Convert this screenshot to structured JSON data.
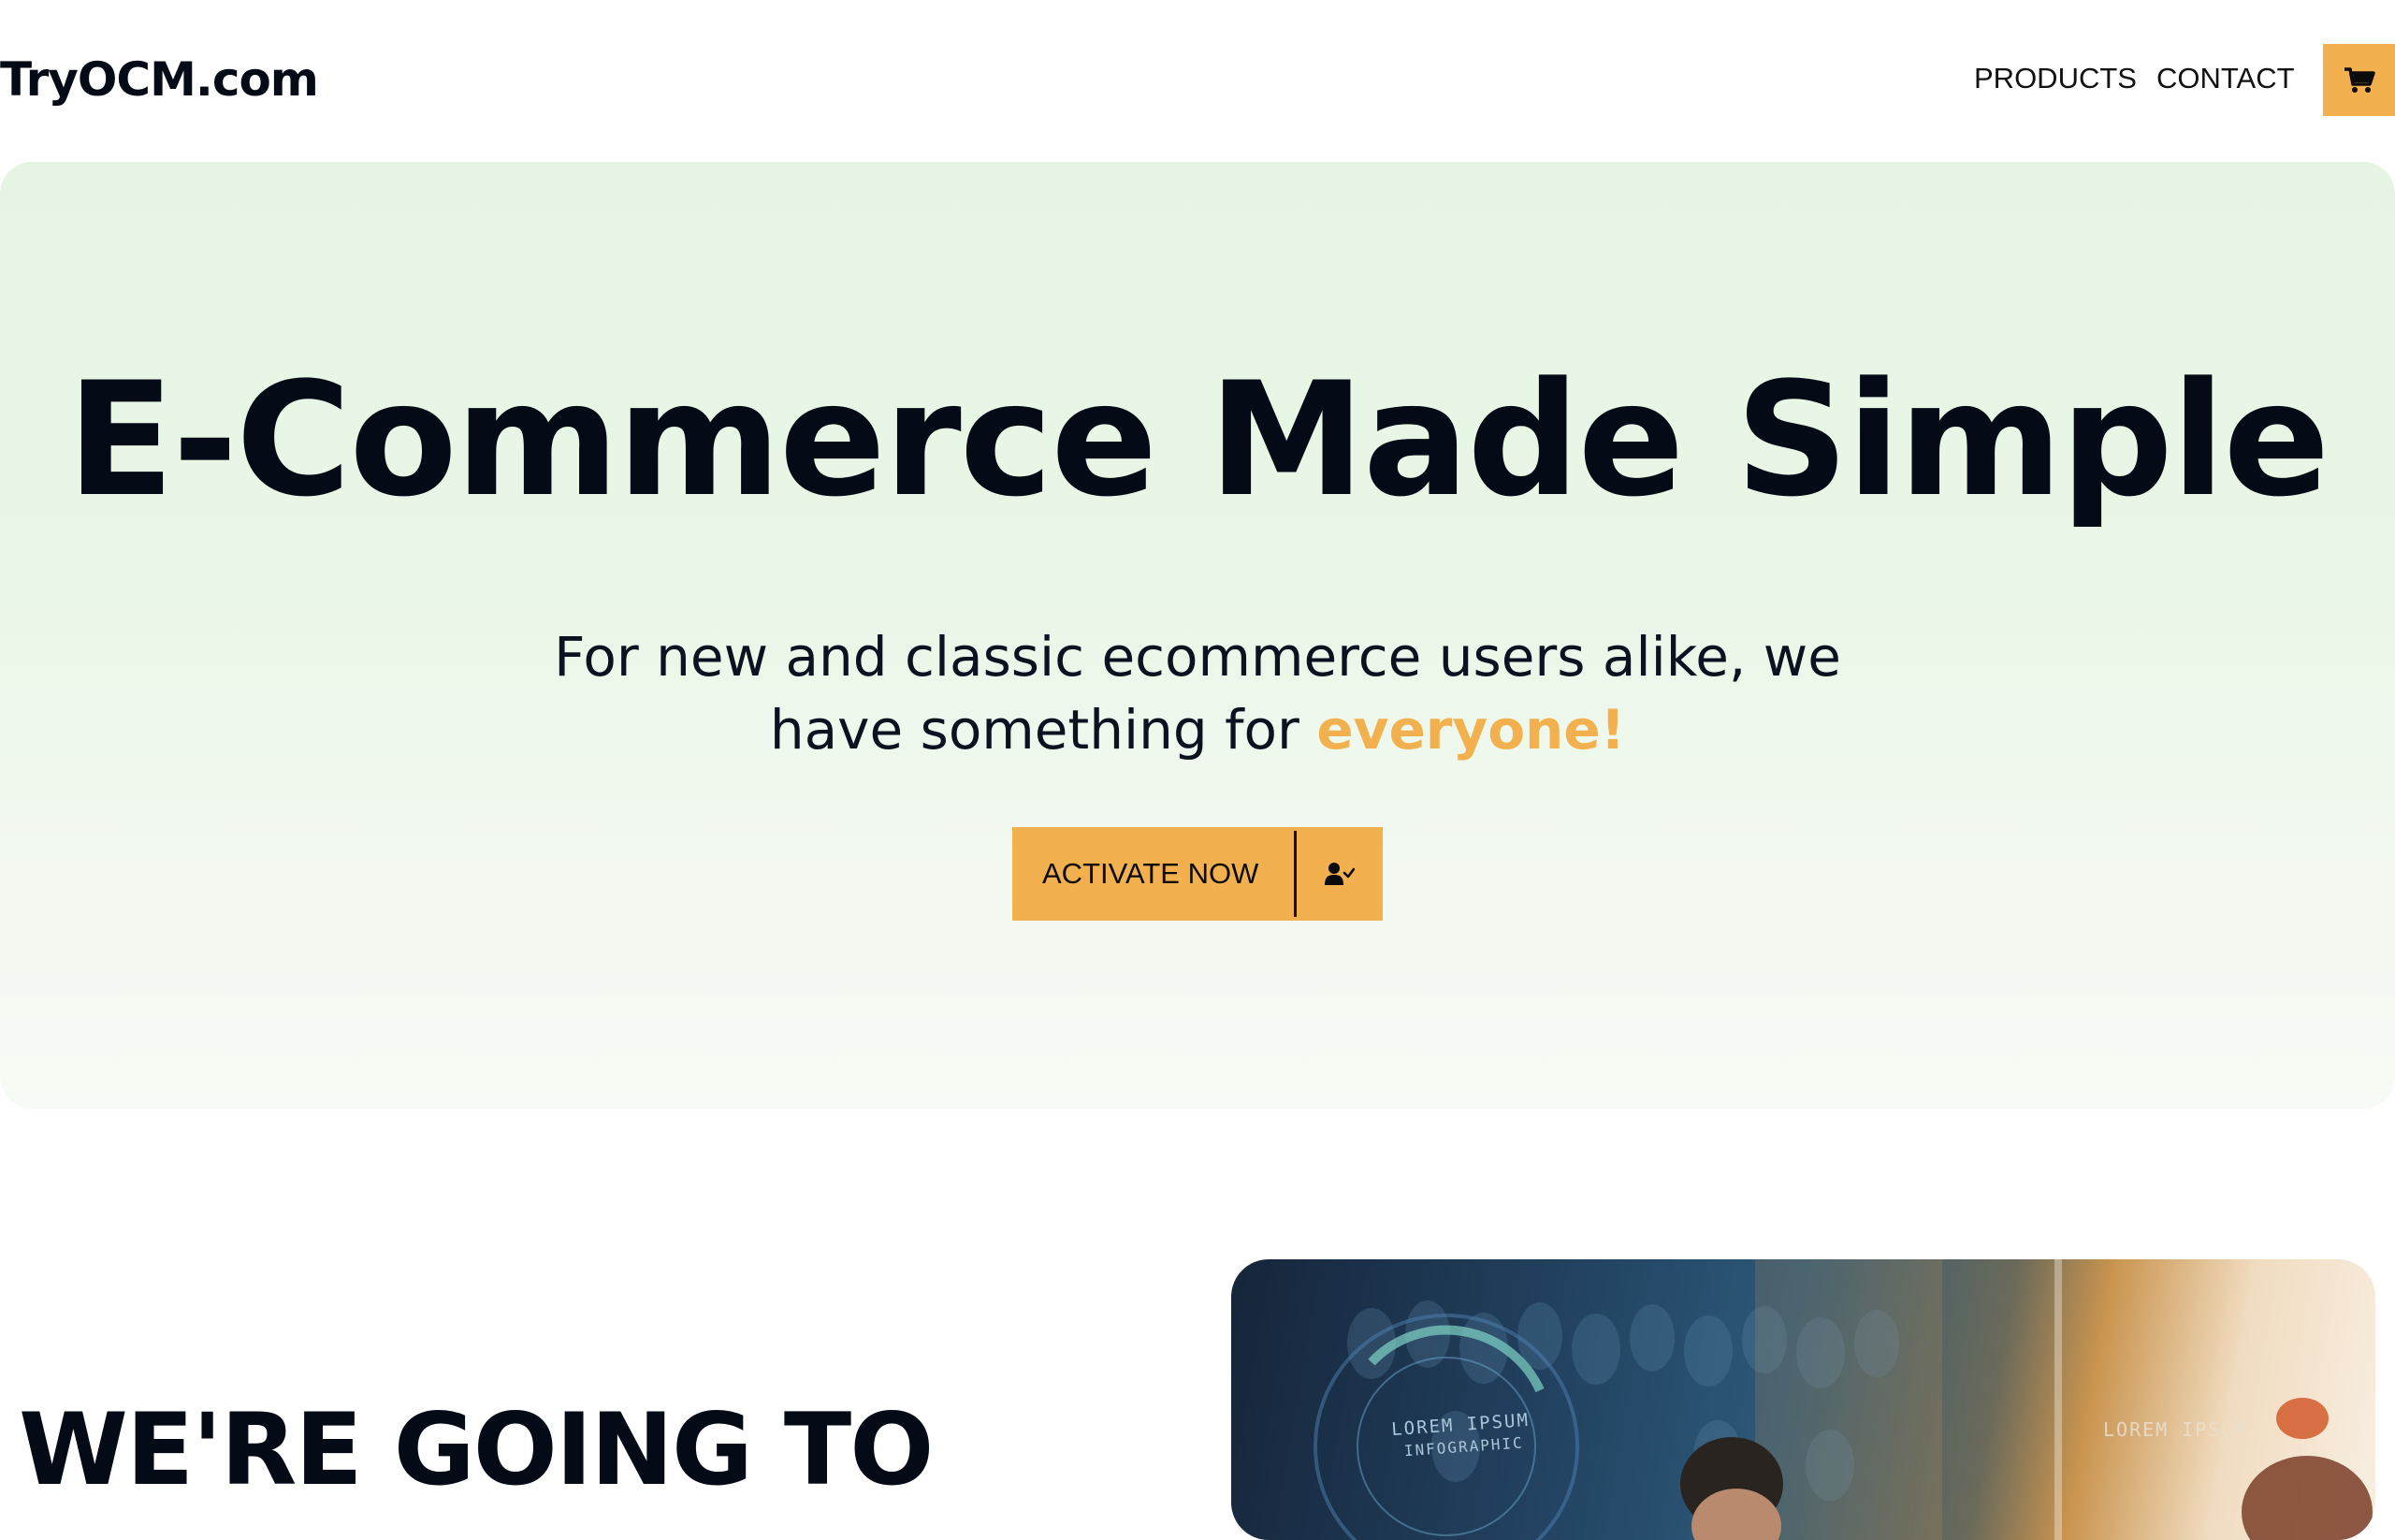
{
  "header": {
    "brand": "TryOCM.com",
    "nav": [
      {
        "label": "PRODUCTS"
      },
      {
        "label": "CONTACT"
      }
    ],
    "cart_icon": "cart-icon"
  },
  "hero": {
    "title": "E-Commerce Made Simple",
    "subtitle_line1": "For new and classic ecommerce users alike, we",
    "subtitle_line2": "have something for",
    "subtitle_accent": "everyone!",
    "cta_label": "ACTIVATE NOW",
    "cta_icon": "user-check-icon"
  },
  "about": {
    "heading": "WE'RE GOING TO",
    "photo_caption_line1": "LOREM IPSUM",
    "photo_caption_line2": "INFOGRAPHIC",
    "photo_caption_right": "LOREM IPSUM"
  },
  "colors": {
    "accent": "#f2b14e",
    "text": "#050b16",
    "hero_bg": "#e6f5e3"
  }
}
